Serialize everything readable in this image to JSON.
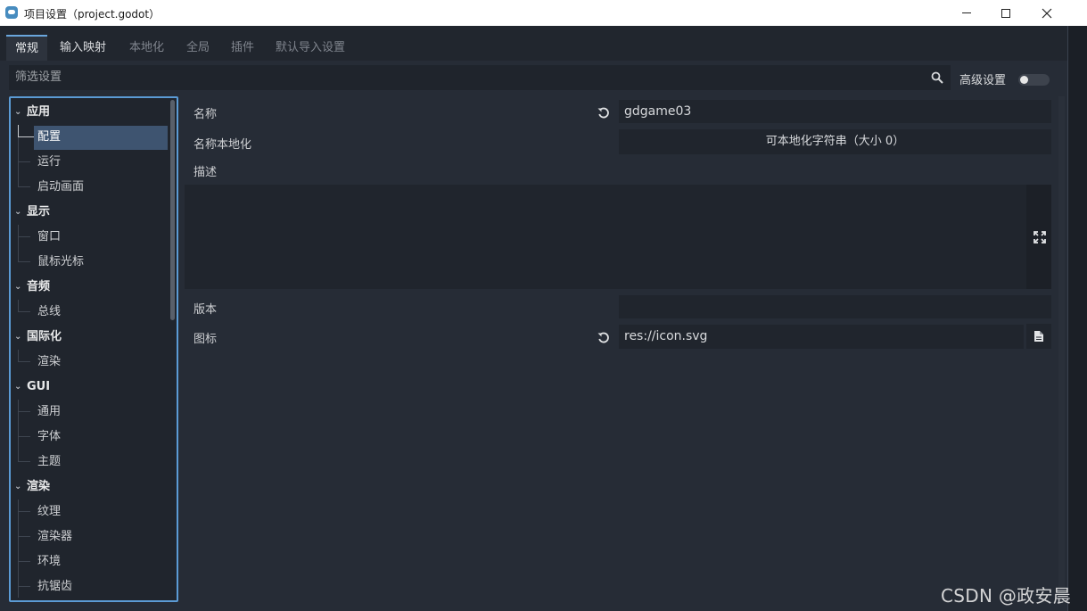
{
  "window": {
    "title": "项目设置（project.godot）",
    "app_icon": "godot-icon",
    "controls": {
      "minimize": "minimize-icon",
      "maximize": "maximize-icon",
      "close": "close-icon"
    }
  },
  "tabs": [
    {
      "label": "常规",
      "active": true
    },
    {
      "label": "输入映射",
      "active": false
    },
    {
      "label": "本地化",
      "active": false
    },
    {
      "label": "全局",
      "active": false
    },
    {
      "label": "插件",
      "active": false
    },
    {
      "label": "默认导入设置",
      "active": false
    }
  ],
  "filter": {
    "placeholder": "筛选设置",
    "search_icon": "search-icon",
    "advanced_label": "高级设置",
    "advanced_enabled": false
  },
  "tree": {
    "categories": [
      {
        "label": "应用",
        "items": [
          "配置",
          "运行",
          "启动画面"
        ]
      },
      {
        "label": "显示",
        "items": [
          "窗口",
          "鼠标光标"
        ]
      },
      {
        "label": "音频",
        "items": [
          "总线"
        ]
      },
      {
        "label": "国际化",
        "items": [
          "渲染"
        ]
      },
      {
        "label": "GUI",
        "items": [
          "通用",
          "字体",
          "主题"
        ]
      },
      {
        "label": "渲染",
        "items": [
          "纹理",
          "渲染器",
          "环境",
          "抗锯齿"
        ]
      }
    ],
    "selected": "配置"
  },
  "properties": {
    "name": {
      "label": "名称",
      "value": "gdgame03"
    },
    "name_localized": {
      "label": "名称本地化",
      "button": "可本地化字符串（大小 0）"
    },
    "description": {
      "label": "描述",
      "value": ""
    },
    "version": {
      "label": "版本",
      "value": ""
    },
    "icon": {
      "label": "图标",
      "value": "res://icon.svg"
    }
  },
  "watermark": "CSDN @政安晨",
  "colors": {
    "accent": "#5b9bd5",
    "selection": "#3e5470",
    "panel": "#262c36",
    "field": "#20252d"
  }
}
